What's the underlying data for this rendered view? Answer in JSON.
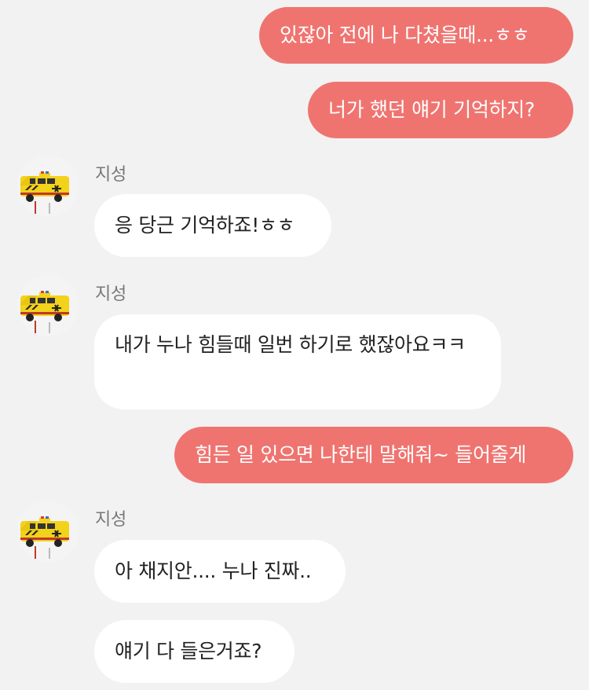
{
  "chat": {
    "contact_name": "지성",
    "avatar_icon": "ambulance-toy-icon",
    "colors": {
      "background": "#f2f2f2",
      "outgoing_bubble": "#ef7470",
      "incoming_bubble": "#ffffff",
      "name_text": "#777777"
    },
    "messages": [
      {
        "sender": "me",
        "text": "있잖아 전에 나 다쳤을때...ㅎㅎ"
      },
      {
        "sender": "me",
        "text": "너가 했던 얘기 기억하지?"
      },
      {
        "sender": "지성",
        "text": "응 당근 기억하죠!ㅎㅎ"
      },
      {
        "sender": "지성",
        "text": "내가 누나 힘들때 일번 하기로 했잖아요ㅋㅋ"
      },
      {
        "sender": "me",
        "text": "힘든 일 있으면 나한테 말해줘~ 들어줄게"
      },
      {
        "sender": "지성",
        "text": "아 채지안.... 누나 진짜.."
      },
      {
        "sender": "지성",
        "text": "얘기 다 들은거죠?"
      }
    ]
  }
}
